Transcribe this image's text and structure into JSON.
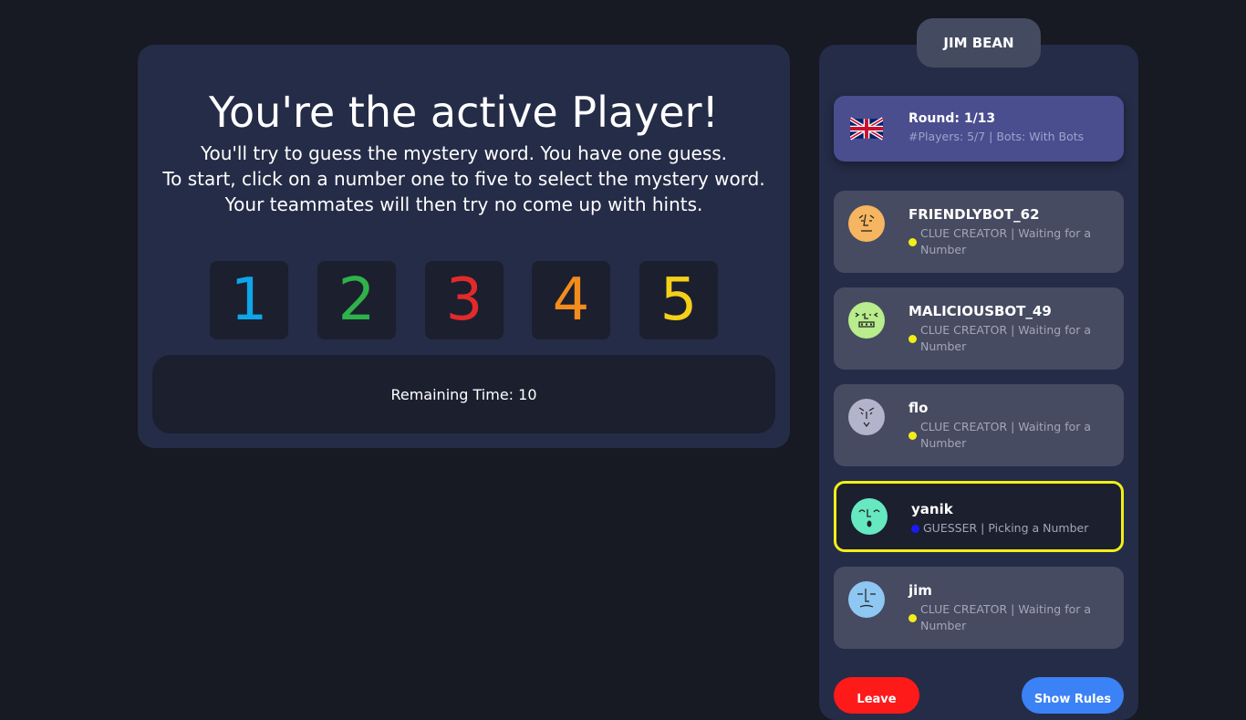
{
  "main": {
    "headline": "You're the active Player!",
    "instructions": [
      "You'll try to guess the mystery word. You have one guess.",
      "To start, click on a number one to five to select the mystery word.",
      "Your teammates will then try no come up with hints."
    ],
    "numbers": [
      {
        "label": "1",
        "color": "#0ea5e9"
      },
      {
        "label": "2",
        "color": "#2fb24a"
      },
      {
        "label": "3",
        "color": "#e32a2a"
      },
      {
        "label": "4",
        "color": "#f28c1c"
      },
      {
        "label": "5",
        "color": "#f5d019"
      }
    ],
    "timer_text": "Remaining Time: 10"
  },
  "sidebar": {
    "current_player": "JIM BEAN",
    "round": {
      "flag_icon": "uk-flag-icon",
      "title": "Round: 1/13",
      "subtitle": "#Players: 5/7 | Bots: With Bots"
    },
    "players": [
      {
        "name": "FRIENDLYBOT_62",
        "status": "CLUE CREATOR | Waiting for a Number",
        "dot_color": "#f2ee18",
        "avatar_color": "#f6b560",
        "active": false
      },
      {
        "name": "MALICIOUSBOT_49",
        "status": "CLUE CREATOR | Waiting for a Number",
        "dot_color": "#f2ee18",
        "avatar_color": "#b8ec8c",
        "active": false
      },
      {
        "name": "flo",
        "status": "CLUE CREATOR | Waiting for a Number",
        "dot_color": "#f2ee18",
        "avatar_color": "#b3b3cc",
        "active": false
      },
      {
        "name": "yanik",
        "status": "GUESSER | Picking a Number",
        "dot_color": "#1a1aff",
        "avatar_color": "#66e8c0",
        "active": true
      },
      {
        "name": "jim",
        "status": "CLUE CREATOR | Waiting for a Number",
        "dot_color": "#f2ee18",
        "avatar_color": "#8ec8f2",
        "active": false
      }
    ],
    "leave_label": "Leave",
    "rules_label": "Show Rules"
  },
  "colors": {
    "background": "#171923",
    "panel": "#252c47",
    "active_border": "#f2ee18"
  }
}
